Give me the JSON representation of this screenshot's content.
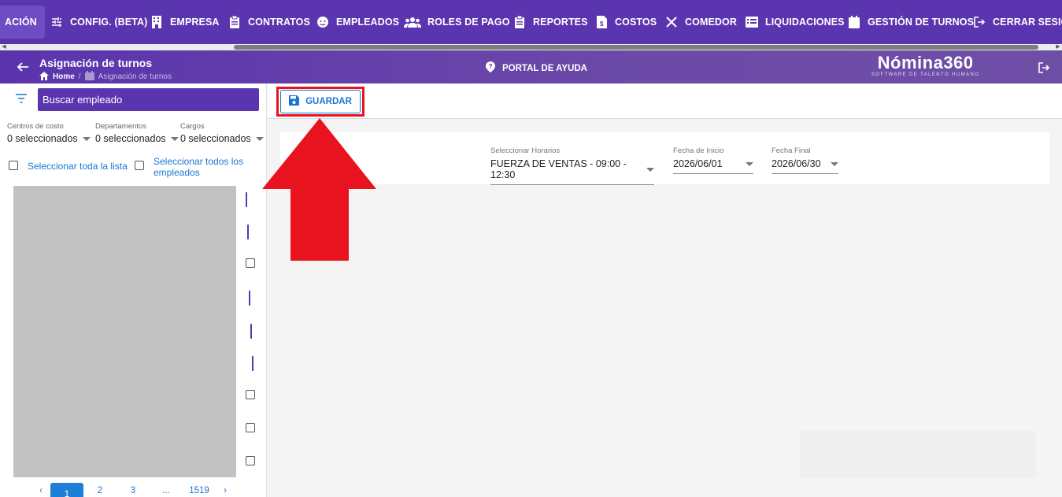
{
  "nav": {
    "items": [
      {
        "label": "ACIÓN",
        "icon": "none",
        "active": true
      },
      {
        "label": "CONFIG. (BETA)",
        "icon": "sliders-icon"
      },
      {
        "label": "EMPRESA",
        "icon": "building-icon"
      },
      {
        "label": "CONTRATOS",
        "icon": "clipboard-icon"
      },
      {
        "label": "EMPLEADOS",
        "icon": "face-icon"
      },
      {
        "label": "ROLES DE PAGO",
        "icon": "group-icon"
      },
      {
        "label": "REPORTES",
        "icon": "clipboard-icon"
      },
      {
        "label": "COSTOS",
        "icon": "invoice-icon"
      },
      {
        "label": "COMEDOR",
        "icon": "utensils-icon"
      },
      {
        "label": "LIQUIDACIONES",
        "icon": "list-icon"
      },
      {
        "label": "GESTIÓN DE TURNOS",
        "icon": "calendar-icon"
      },
      {
        "label": "CERRAR SESIÓN",
        "icon": "logout-icon"
      }
    ]
  },
  "header": {
    "title": "Asignación de turnos",
    "breadcrumb_home": "Home",
    "breadcrumb_sep": "/",
    "breadcrumb_current": "Asignación de turnos",
    "help_label": "PORTAL DE AYUDA",
    "brand_name": "Nómina360",
    "brand_tagline": "SOFTWARE DE TALENTO HUMANO"
  },
  "sidebar": {
    "search_placeholder": "Buscar empleado",
    "filters": [
      {
        "label": "Centros de costo",
        "value": "0 seleccionados"
      },
      {
        "label": "Departamentos",
        "value": "0 seleccionados"
      },
      {
        "label": "Cargos",
        "value": "0 seleccionados"
      }
    ],
    "select_list_label": "Seleccionar toda la lista",
    "select_all_label_1": "Seleccionar todos los",
    "select_all_label_2": "empleados",
    "employee_checks": [
      true,
      true,
      false,
      true,
      true,
      true,
      false,
      false,
      false
    ],
    "pager": {
      "prev": "‹",
      "pages": [
        "1",
        "2",
        "3",
        "...",
        "1519"
      ],
      "next": "›",
      "current": "1"
    }
  },
  "toolbar": {
    "save_label": "GUARDAR"
  },
  "form": {
    "horario_label": "Seleccionar Horarios",
    "horario_value": "FUERZA DE VENTAS - 09:00 - 12:30",
    "inicio_label": "Fecha de Inicio",
    "inicio_value": "2026/06/01",
    "final_label": "Fecha Final",
    "final_value": "2026/06/30"
  },
  "colors": {
    "primary": "#5b35b0",
    "accent": "#1976d2",
    "highlight": "#e8131e"
  }
}
